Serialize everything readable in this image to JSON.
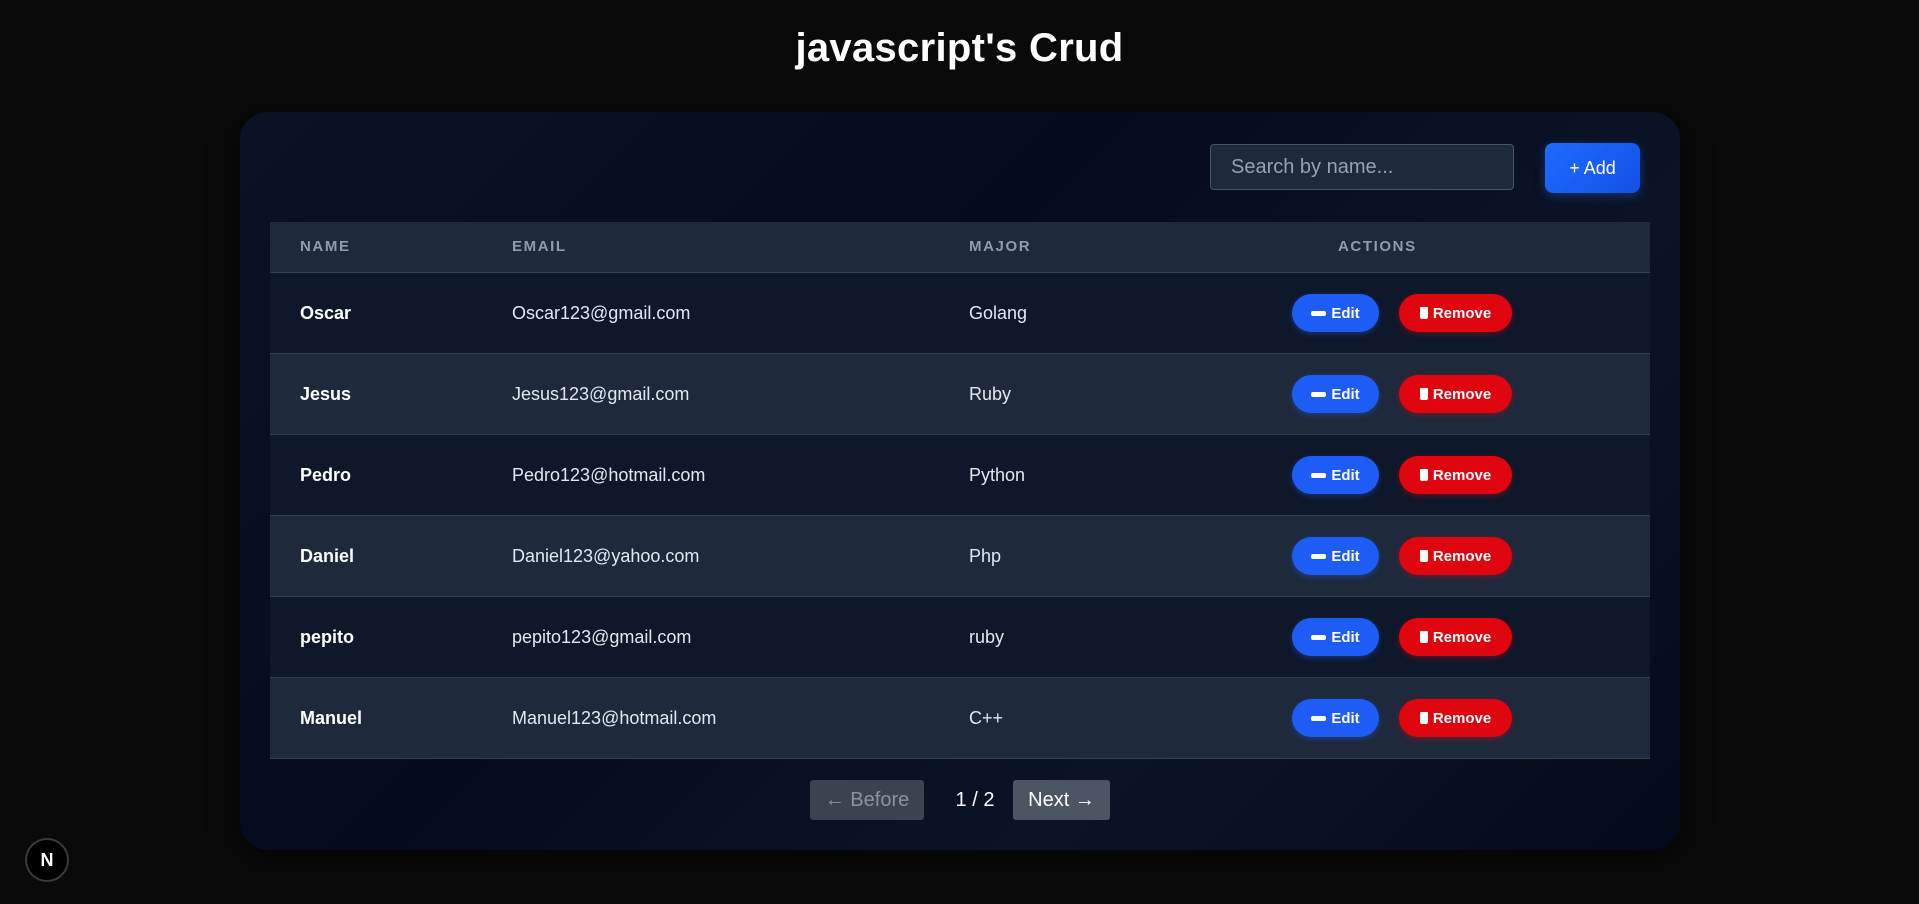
{
  "page": {
    "title": "javascript's Crud"
  },
  "toolbar": {
    "search_placeholder": "Search by name...",
    "add_label": "+ Add"
  },
  "table": {
    "columns": [
      "NAME",
      "EMAIL",
      "MAJOR",
      "ACTIONS"
    ],
    "rows": [
      {
        "name": "Oscar",
        "email": "Oscar123@gmail.com",
        "major": "Golang"
      },
      {
        "name": "Jesus",
        "email": "Jesus123@gmail.com",
        "major": "Ruby"
      },
      {
        "name": "Pedro",
        "email": "Pedro123@hotmail.com",
        "major": "Python"
      },
      {
        "name": "Daniel",
        "email": "Daniel123@yahoo.com",
        "major": "Php"
      },
      {
        "name": "pepito",
        "email": "pepito123@gmail.com",
        "major": "ruby"
      },
      {
        "name": "Manuel",
        "email": "Manuel123@hotmail.com",
        "major": "C++"
      }
    ],
    "edit_label": "Edit",
    "remove_label": "Remove",
    "edit_icon": "pencil-icon",
    "remove_icon": "trash-icon"
  },
  "pagination": {
    "before_label": "← Before",
    "page_indicator": "1 / 2",
    "next_label": "Next →"
  },
  "badge": {
    "label": "N",
    "icon": "nextjs-logo-icon"
  },
  "colors": {
    "background": "#0a0a0a",
    "accent": "#1d5cf5",
    "danger": "#e0060f",
    "header_row": "#1e293b"
  }
}
